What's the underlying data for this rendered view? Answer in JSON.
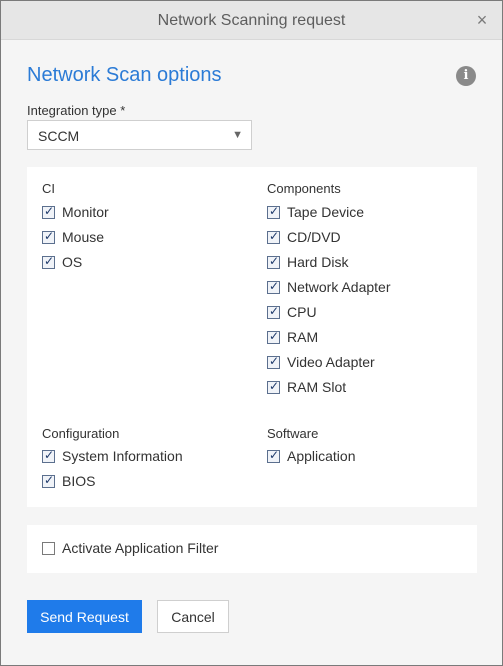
{
  "window": {
    "title": "Network Scanning request",
    "close_glyph": "×"
  },
  "heading": "Network Scan options",
  "info_glyph": "i",
  "integration": {
    "label": "Integration type *",
    "value": "SCCM"
  },
  "groups": {
    "ci": {
      "label": "CI",
      "items": [
        {
          "label": "Monitor",
          "checked": true
        },
        {
          "label": "Mouse",
          "checked": true
        },
        {
          "label": "OS",
          "checked": true
        }
      ]
    },
    "components": {
      "label": "Components",
      "items": [
        {
          "label": "Tape Device",
          "checked": true
        },
        {
          "label": "CD/DVD",
          "checked": true
        },
        {
          "label": "Hard Disk",
          "checked": true
        },
        {
          "label": "Network Adapter",
          "checked": true
        },
        {
          "label": "CPU",
          "checked": true
        },
        {
          "label": "RAM",
          "checked": true
        },
        {
          "label": "Video Adapter",
          "checked": true
        },
        {
          "label": "RAM Slot",
          "checked": true
        }
      ]
    },
    "configuration": {
      "label": "Configuration",
      "items": [
        {
          "label": "System Information",
          "checked": true
        },
        {
          "label": "BIOS",
          "checked": true
        }
      ]
    },
    "software": {
      "label": "Software",
      "items": [
        {
          "label": "Application",
          "checked": true
        }
      ]
    }
  },
  "filter": {
    "label": "Activate Application Filter",
    "checked": false
  },
  "buttons": {
    "send": "Send Request",
    "cancel": "Cancel"
  },
  "colors": {
    "accent": "#1f7bea",
    "heading": "#2b7bd6",
    "title_bar": "#e6e6e6"
  }
}
